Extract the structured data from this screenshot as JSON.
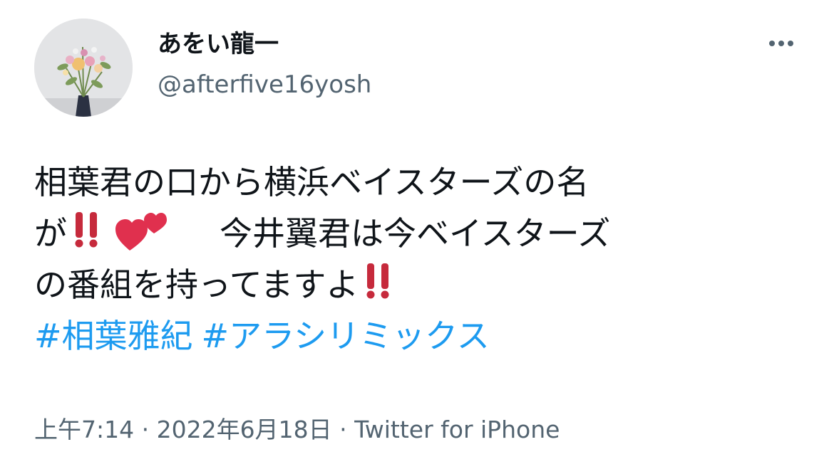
{
  "author": {
    "display_name": "あをい龍一",
    "handle": "@afterfive16yosh",
    "avatar_icon": "flower-bouquet-avatar"
  },
  "more_icon": "more-options-icon",
  "tweet": {
    "line1": "相葉君の口から横浜ベイスターズの名",
    "line2_start": "が",
    "line2_end": "今井翼君は今ベイスターズ",
    "line3": "の番組を持ってますよ",
    "emoji": [
      "double-exclamation-icon",
      "two-hearts-icon",
      "double-exclamation-icon"
    ],
    "hashtags": [
      "#相葉雅紀",
      "#アラシリミックス"
    ]
  },
  "meta": {
    "time": "上午7:14",
    "separator1": " · ",
    "date": "2022年6月18日",
    "separator2": " · ",
    "source": "Twitter for iPhone"
  },
  "colors": {
    "link": "#1d9bf0",
    "secondary_text": "#536471",
    "emoji_red": "#c62a3c",
    "heart_pink": "#e0304e"
  }
}
